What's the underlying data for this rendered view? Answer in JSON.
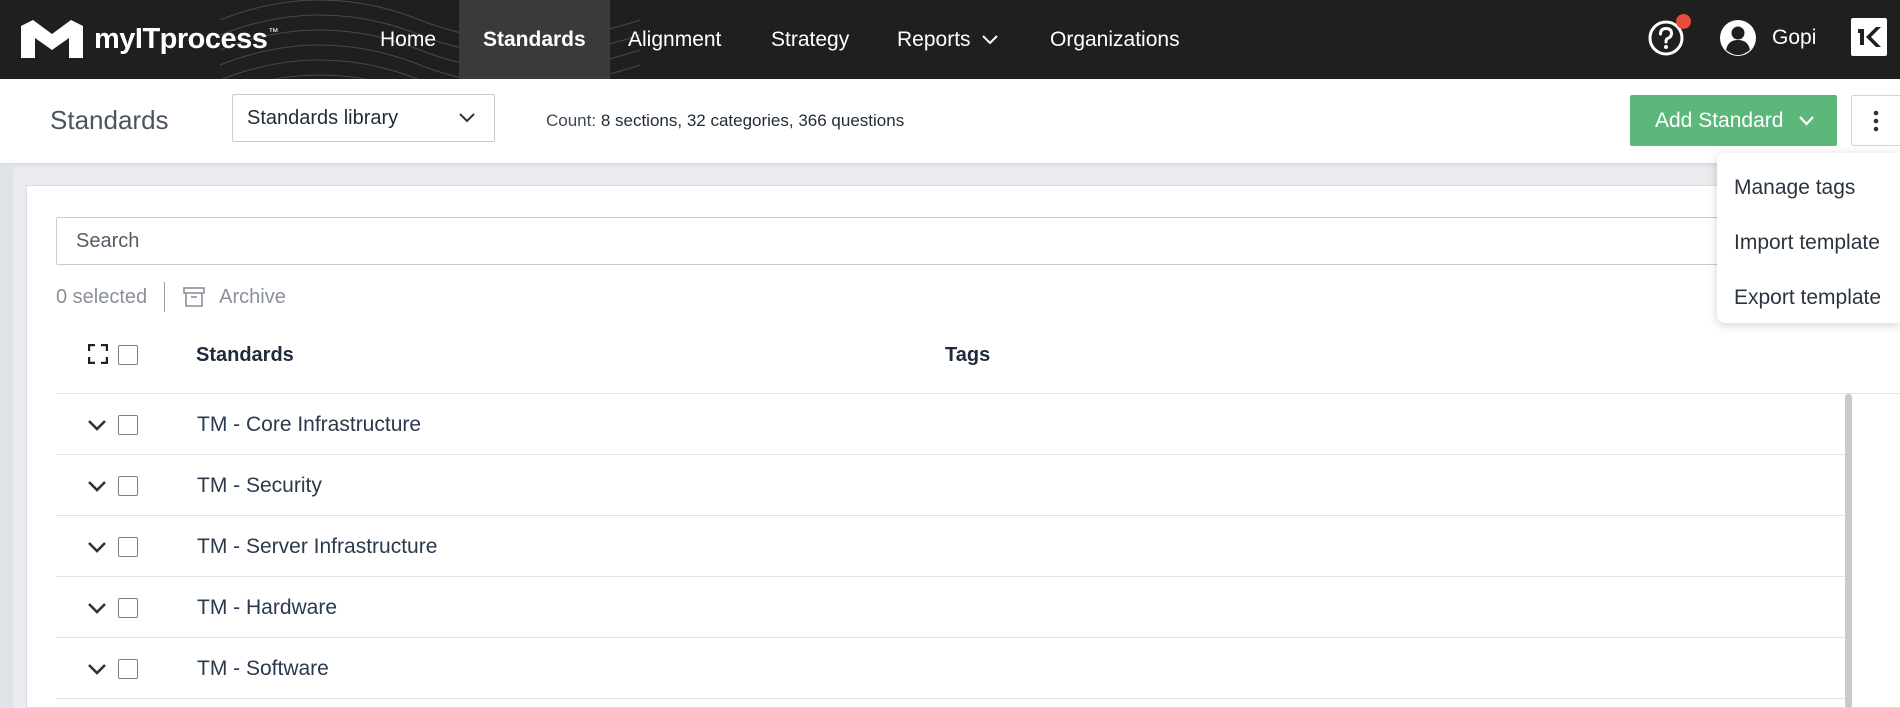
{
  "app": {
    "name": "myITprocess",
    "trademark": "™"
  },
  "nav": {
    "items": [
      {
        "label": "Home"
      },
      {
        "label": "Standards"
      },
      {
        "label": "Alignment"
      },
      {
        "label": "Strategy"
      },
      {
        "label": "Reports"
      },
      {
        "label": "Organizations"
      }
    ],
    "active": "Standards"
  },
  "user": {
    "name": "Gopi"
  },
  "header": {
    "title": "Standards",
    "library_select": "Standards library",
    "count_label": "Count:",
    "count_value": "8 sections, 32 categories, 366 questions",
    "add_button": "Add Standard"
  },
  "search": {
    "placeholder": "Search"
  },
  "selection": {
    "selected_text": "0 selected",
    "archive_label": "Archive"
  },
  "table": {
    "columns": [
      "Standards",
      "Tags"
    ],
    "rows": [
      {
        "name": "TM - Core Infrastructure"
      },
      {
        "name": "TM - Security"
      },
      {
        "name": "TM - Server Infrastructure"
      },
      {
        "name": "TM - Hardware"
      },
      {
        "name": "TM - Software"
      }
    ]
  },
  "menu": {
    "items": [
      "Manage tags",
      "Import template",
      "Export template"
    ]
  },
  "colors": {
    "nav_bg": "#1f1f1f",
    "accent_green": "#5cb87a",
    "notification": "#e74c3c"
  }
}
